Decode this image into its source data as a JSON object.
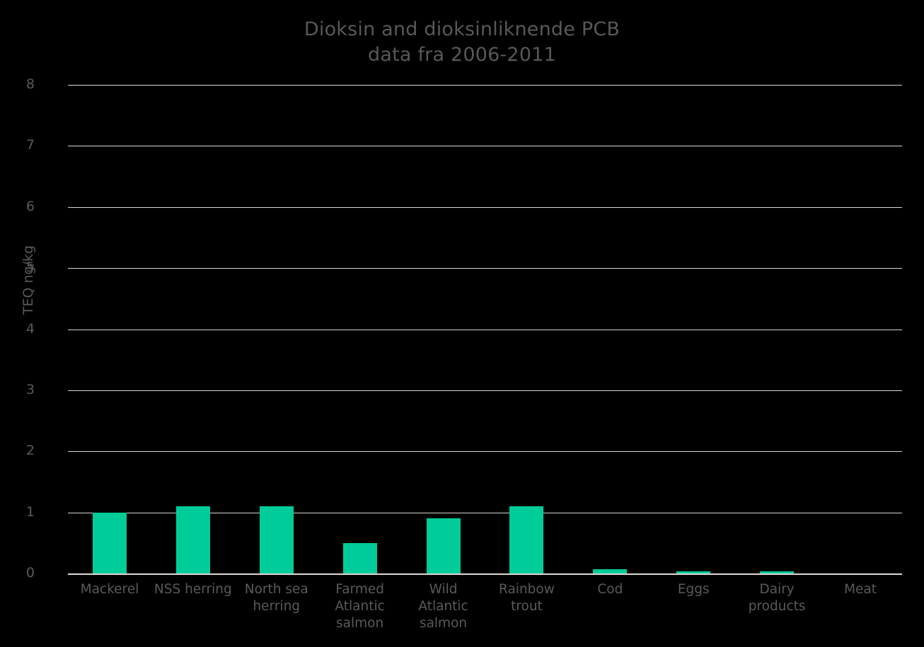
{
  "chart_data": {
    "type": "bar",
    "title": "Dioksin and dioksinliknende PCB\ndata fra 2006-2011",
    "title_lines": [
      "Dioksin and dioksinliknende PCB",
      "data fra 2006-2011"
    ],
    "xlabel": "",
    "ylabel": "TEQ ng/kg",
    "ylim": [
      0,
      8
    ],
    "yticks": [
      0,
      1,
      2,
      3,
      4,
      5,
      6,
      7,
      8
    ],
    "ytick_labels": [
      "0",
      "1",
      "2",
      "3",
      "4",
      "5",
      "6",
      "7",
      "8"
    ],
    "grid": true,
    "legend": "none",
    "bar_color": "#00cc99",
    "background_color": "#000000",
    "text_color": "#5a5a5a",
    "gridline_color": "#d9d6d2",
    "categories": [
      "Mackerel",
      "NSS herring",
      "North sea\nherring",
      "Farmed\nAtlantic\nsalmon",
      "Wild\nAtlantic\nsalmon",
      "Rainbow\ntrout",
      "Cod",
      "Eggs",
      "Dairy\nproducts",
      "Meat"
    ],
    "values": [
      1.0,
      1.1,
      1.1,
      0.5,
      0.9,
      1.1,
      0.07,
      0.03,
      0.04,
      0.0
    ]
  }
}
